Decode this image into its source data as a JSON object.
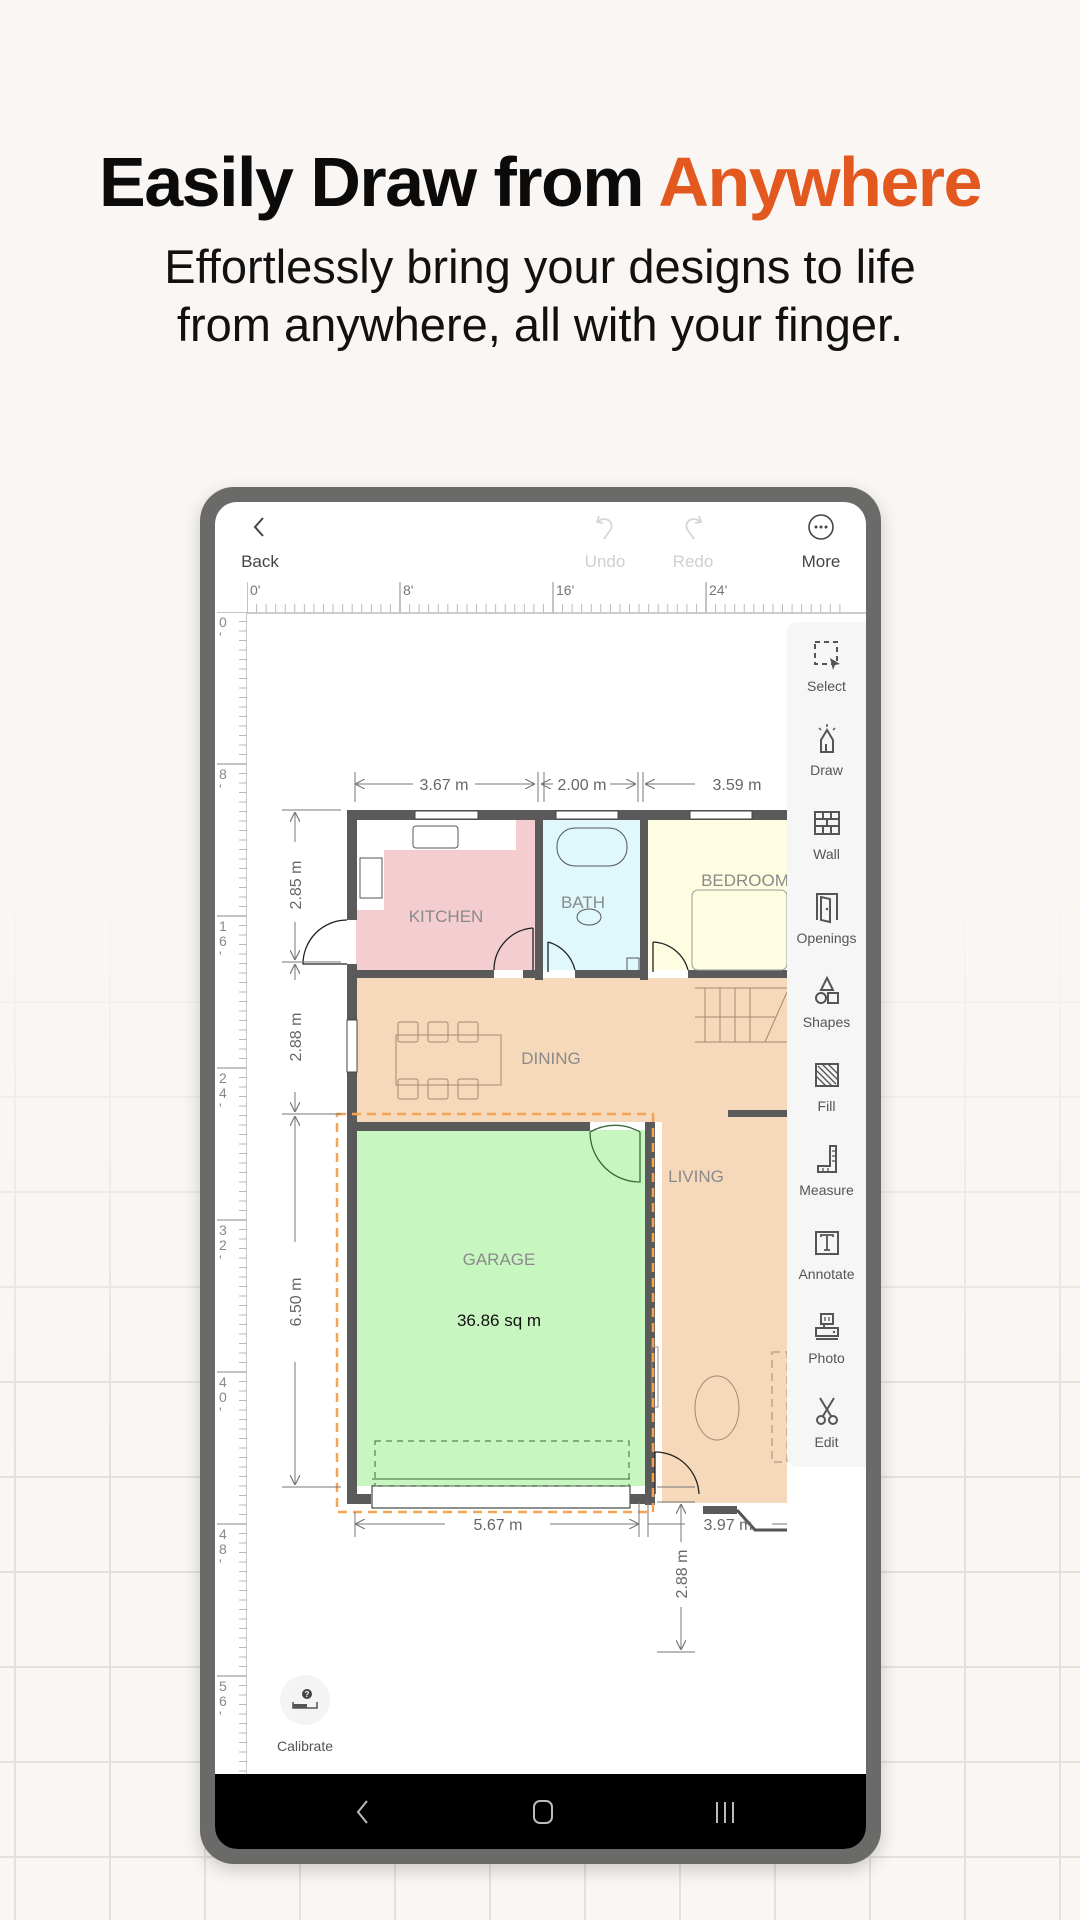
{
  "headline": {
    "text": "Easily Draw from",
    "accent": "Anywhere"
  },
  "subheadline": {
    "line1": "Effortlessly bring your designs to life",
    "line2": "from anywhere, all with your finger."
  },
  "colors": {
    "accent": "#e2581f",
    "kitchen": "#f3cdd0",
    "bath": "#def8fb",
    "bedroom": "#fefde2",
    "dining_living": "#f6d9bb",
    "garage": "#c8f6c0",
    "wall": "#555555",
    "selection": "#f3a553"
  },
  "topbar": {
    "back": {
      "label": "Back",
      "icon": "chevron-left-icon"
    },
    "undo": {
      "label": "Undo",
      "icon": "undo-icon",
      "enabled": false
    },
    "redo": {
      "label": "Redo",
      "icon": "redo-icon",
      "enabled": false
    },
    "more": {
      "label": "More",
      "icon": "more-icon"
    }
  },
  "ruler": {
    "top_labels": [
      "0'",
      "8'",
      "16'",
      "24'"
    ],
    "left_labels": [
      "0'",
      "8'",
      "16'",
      "24'",
      "32'",
      "40'",
      "48'",
      "56'"
    ]
  },
  "floorplan": {
    "rooms": [
      {
        "name": "KITCHEN"
      },
      {
        "name": "BATH"
      },
      {
        "name": "BEDROOM"
      },
      {
        "name": "DINING"
      },
      {
        "name": "LIVING"
      },
      {
        "name": "GARAGE",
        "area": "36.86 sq m",
        "selected": true
      }
    ],
    "dimensions": {
      "top": [
        "3.67 m",
        "2.00 m",
        "3.59 m"
      ],
      "left": [
        "2.85 m",
        "2.88 m",
        "6.50 m"
      ],
      "bottom": [
        "5.67 m",
        "3.97 m"
      ],
      "right": [
        "2.88 m"
      ]
    }
  },
  "toolbar": [
    {
      "label": "Select",
      "icon": "select-icon"
    },
    {
      "label": "Draw",
      "icon": "draw-icon"
    },
    {
      "label": "Wall",
      "icon": "wall-icon"
    },
    {
      "label": "Openings",
      "icon": "door-icon"
    },
    {
      "label": "Shapes",
      "icon": "shapes-icon"
    },
    {
      "label": "Fill",
      "icon": "fill-icon"
    },
    {
      "label": "Measure",
      "icon": "measure-icon"
    },
    {
      "label": "Annotate",
      "icon": "annotate-icon"
    },
    {
      "label": "Photo",
      "icon": "photo-icon"
    },
    {
      "label": "Edit",
      "icon": "scissors-icon"
    }
  ],
  "calibrate": {
    "label": "Calibrate",
    "icon": "calibrate-icon"
  },
  "navbar": {
    "back": "nav-back-icon",
    "home": "nav-home-icon",
    "recents": "nav-recents-icon"
  }
}
